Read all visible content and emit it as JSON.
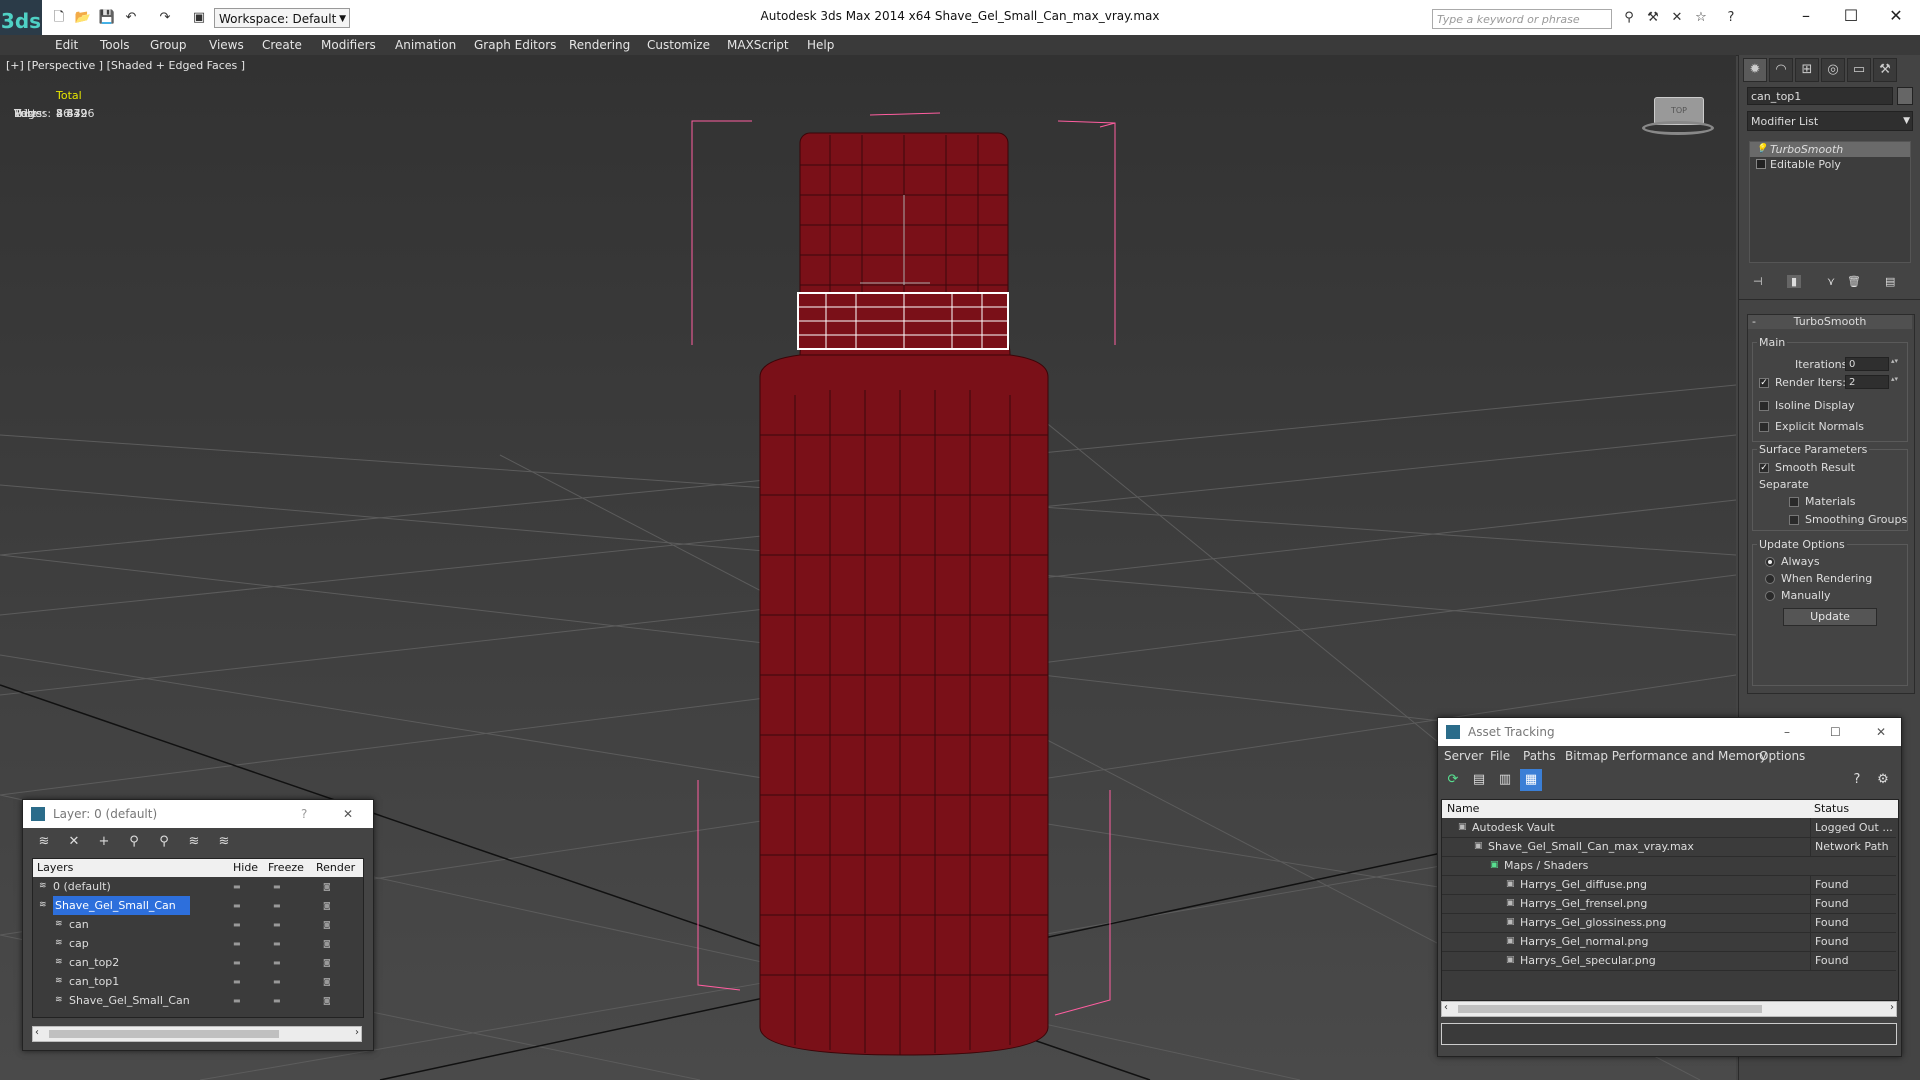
{
  "app": {
    "title": "Autodesk 3ds Max  2014 x64       Shave_Gel_Small_Can_max_vray.max",
    "logo": "3ds",
    "workspace": "Workspace: Default",
    "search_placeholder": "Type a keyword or phrase"
  },
  "menu": [
    "Edit",
    "Tools",
    "Group",
    "Views",
    "Create",
    "Modifiers",
    "Animation",
    "Graph Editors",
    "Rendering",
    "Customize",
    "MAXScript",
    "Help"
  ],
  "viewport": {
    "label": "[+] [Perspective ] [Shaded + Edged Faces ]",
    "stats": {
      "header": "Total",
      "rows": [
        {
          "k": "Polys:",
          "v": "8 832"
        },
        {
          "k": "Tris:",
          "v": "8 832"
        },
        {
          "k": "Edges:",
          "v": "26 496"
        },
        {
          "k": "Verts:",
          "v": "4 479"
        }
      ]
    },
    "colors": {
      "mesh": "#7a1018",
      "selection": "#ff5ea0",
      "wire": "#ffffff"
    },
    "viewcube_label": "TOP"
  },
  "command_panel": {
    "object_name": "can_top1",
    "modifier_list_label": "Modifier List",
    "modifiers": [
      "TurboSmooth",
      "Editable Poly"
    ],
    "turbosmooth": {
      "title": "TurboSmooth",
      "main_label": "Main",
      "iterations_label": "Iterations:",
      "iterations_value": "0",
      "render_iters_label": "Render Iters:",
      "render_iters_value": "2",
      "render_iters_checked": true,
      "isoline_label": "Isoline Display",
      "explicit_normals_label": "Explicit Normals",
      "surface_params_label": "Surface Parameters",
      "smooth_result_label": "Smooth Result",
      "separate_label": "Separate",
      "materials_label": "Materials",
      "smoothing_groups_label": "Smoothing Groups",
      "update_options_label": "Update Options",
      "always_label": "Always",
      "when_rendering_label": "When Rendering",
      "manually_label": "Manually",
      "update_button": "Update",
      "collapse_sign": "-"
    }
  },
  "layer_dialog": {
    "title": "Layer: 0 (default)",
    "help": "?",
    "close": "✕",
    "columns": [
      "Layers",
      "Hide",
      "Freeze",
      "Render"
    ],
    "rows": [
      {
        "name": "0 (default)",
        "indent": 1,
        "selected": false
      },
      {
        "name": "Shave_Gel_Small_Can",
        "indent": 1,
        "selected": true
      },
      {
        "name": "can",
        "indent": 2,
        "selected": false
      },
      {
        "name": "cap",
        "indent": 2,
        "selected": false
      },
      {
        "name": "can_top2",
        "indent": 2,
        "selected": false
      },
      {
        "name": "can_top1",
        "indent": 2,
        "selected": false
      },
      {
        "name": "Shave_Gel_Small_Can",
        "indent": 2,
        "selected": false
      }
    ]
  },
  "asset_dialog": {
    "title": "Asset Tracking",
    "menu": [
      "Server",
      "File",
      "Paths",
      "Bitmap Performance and Memory",
      "Options"
    ],
    "columns": [
      "Name",
      "Status"
    ],
    "rows": [
      {
        "name": "Autodesk Vault",
        "status": "Logged Out ...",
        "indent": 1
      },
      {
        "name": "Shave_Gel_Small_Can_max_vray.max",
        "status": "Network Path",
        "indent": 2
      },
      {
        "name": "Maps / Shaders",
        "status": "",
        "indent": 3
      },
      {
        "name": "Harrys_Gel_diffuse.png",
        "status": "Found",
        "indent": 4
      },
      {
        "name": "Harrys_Gel_frensel.png",
        "status": "Found",
        "indent": 4
      },
      {
        "name": "Harrys_Gel_glossiness.png",
        "status": "Found",
        "indent": 4
      },
      {
        "name": "Harrys_Gel_normal.png",
        "status": "Found",
        "indent": 4
      },
      {
        "name": "Harrys_Gel_specular.png",
        "status": "Found",
        "indent": 4
      }
    ]
  }
}
